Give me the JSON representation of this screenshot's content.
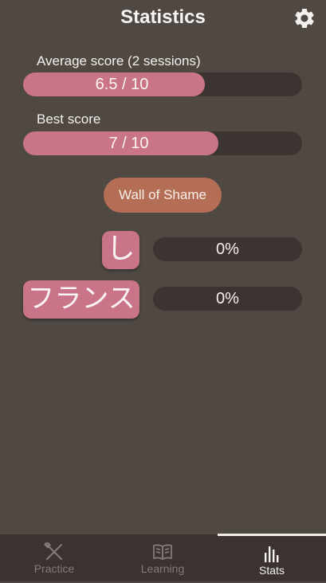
{
  "header": {
    "title": "Statistics",
    "settings_icon": "gear-icon"
  },
  "stats": {
    "average": {
      "label": "Average score (2 sessions)",
      "value_text": "6.5 / 10",
      "fraction": 0.65
    },
    "best": {
      "label": "Best score",
      "value_text": "7 / 10",
      "fraction": 0.7
    }
  },
  "wall_button": "Wall of Shame",
  "shame_items": [
    {
      "word": "し",
      "percent": "0%"
    },
    {
      "word": "フランス",
      "percent": "0%"
    }
  ],
  "nav": {
    "items": [
      {
        "label": "Practice",
        "icon": "pencil-cross-icon",
        "active": false
      },
      {
        "label": "Learning",
        "icon": "book-icon",
        "active": false
      },
      {
        "label": "Stats",
        "icon": "bar-chart-icon",
        "active": true
      }
    ]
  },
  "colors": {
    "background": "#4f4843",
    "track": "#3c3431",
    "accent_pink": "#c97488",
    "accent_brown": "#b46e55",
    "navbar": "#3b3331"
  }
}
